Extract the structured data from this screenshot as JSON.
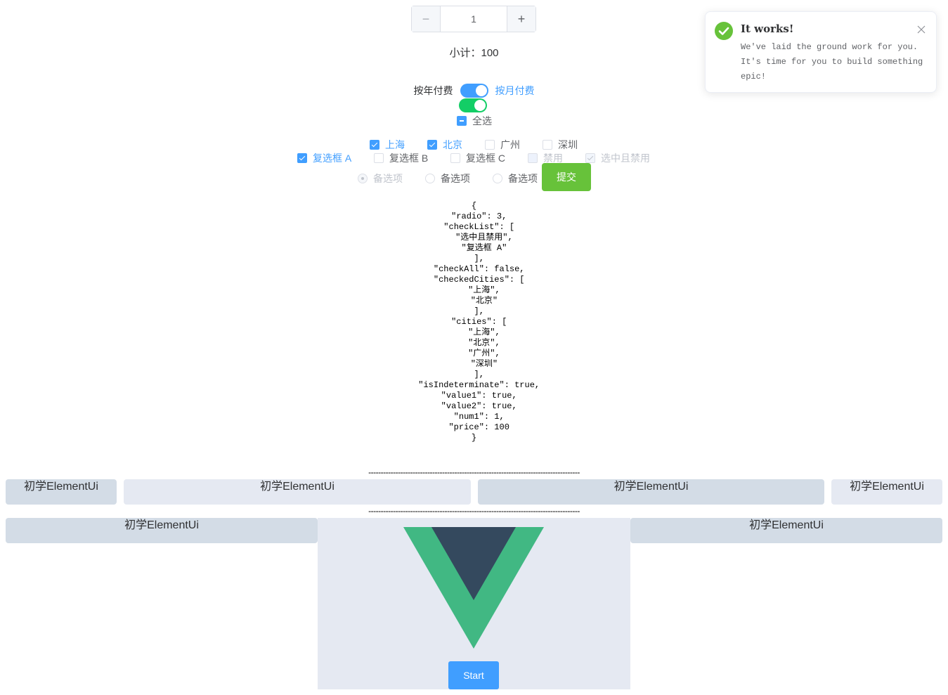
{
  "stepper": {
    "minus": "−",
    "value": "1",
    "plus": "+"
  },
  "subtotal": "小计：100",
  "switch1": {
    "inactive_text": "按年付费",
    "active_text": "按月付费",
    "color": "#409eff"
  },
  "switch2": {
    "color": "#13ce66"
  },
  "check_all": {
    "label": "全选"
  },
  "cities": [
    "上海",
    "北京",
    "广州",
    "深圳"
  ],
  "checkboxes": [
    "复选框 A",
    "复选框 B",
    "复选框 C",
    "禁用",
    "选中且禁用"
  ],
  "radios": [
    "备选项",
    "备选项",
    "备选项"
  ],
  "submit_label": "提交",
  "json_dump": "{\n  \"radio\": 3,\n  \"checkList\": [\n    \"选中且禁用\",\n    \"复选框 A\"\n  ],\n  \"checkAll\": false,\n  \"checkedCities\": [\n    \"上海\",\n    \"北京\"\n  ],\n  \"cities\": [\n    \"上海\",\n    \"北京\",\n    \"广州\",\n    \"深圳\"\n  ],\n  \"isIndeterminate\": true,\n  \"value1\": true,\n  \"value2\": true,\n  \"num1\": 1,\n  \"price\": 100\n}",
  "divider": "--------------------------------------------------------------------------------------",
  "grid_row1": [
    "初学ElementUi",
    "初学ElementUi",
    "初学ElementUi",
    "初学ElementUi"
  ],
  "grid_row2": [
    "初学ElementUi",
    "初学ElementUi"
  ],
  "logo": {
    "name": "vue-logo",
    "outer_color": "#41b883",
    "inner_color": "#34495e"
  },
  "start_label": "Start",
  "notification": {
    "title": "It works!",
    "message": "We've laid the ground work for you. It's time for you to build something epic!",
    "icon": "success-check-icon",
    "icon_color": "#67c23a"
  }
}
